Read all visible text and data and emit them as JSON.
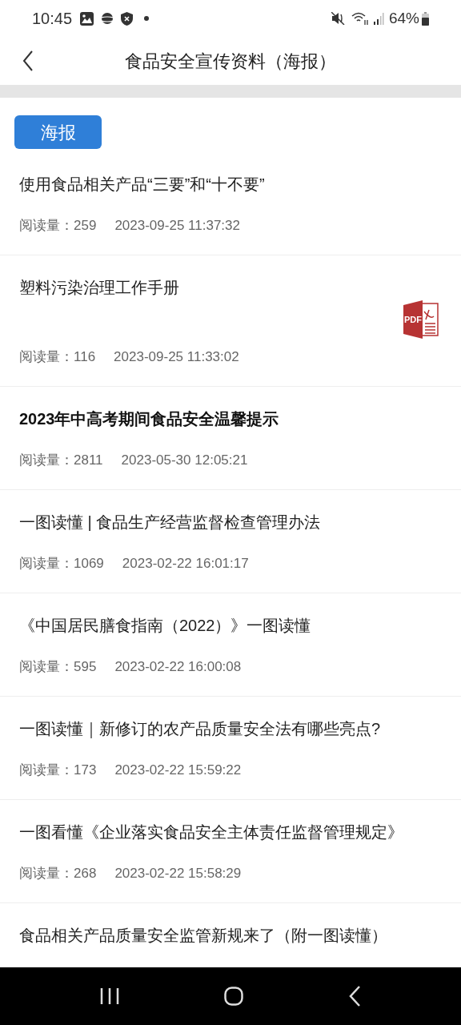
{
  "status_bar": {
    "time": "10:45",
    "battery": "64%"
  },
  "header": {
    "title": "食品安全宣传资料（海报）"
  },
  "category_tag": "海报",
  "articles": [
    {
      "title": "使用食品相关产品“三要”和“十不要”",
      "views_label": "阅读量：",
      "views": "259",
      "date": "2023-09-25 11:37:32",
      "kind": "plain",
      "emphasized": false
    },
    {
      "title": "塑料污染治理工作手册",
      "views_label": "阅读量：",
      "views": "116",
      "date": "2023-09-25 11:33:02",
      "kind": "pdf",
      "attachment_label": "PDF",
      "emphasized": false
    },
    {
      "title": "2023年中高考期间食品安全温馨提示",
      "views_label": "阅读量：",
      "views": "2811",
      "date": "2023-05-30 12:05:21",
      "kind": "plain",
      "emphasized": true
    },
    {
      "title": "一图读懂 | 食品生产经营监督检查管理办法",
      "views_label": "阅读量：",
      "views": "1069",
      "date": "2023-02-22 16:01:17",
      "kind": "plain",
      "emphasized": false
    },
    {
      "title": "《中国居民膳食指南（2022）》一图读懂",
      "views_label": "阅读量：",
      "views": "595",
      "date": "2023-02-22 16:00:08",
      "kind": "plain",
      "emphasized": false
    },
    {
      "title": "一图读懂｜新修订的农产品质量安全法有哪些亮点?",
      "views_label": "阅读量：",
      "views": "173",
      "date": "2023-02-22 15:59:22",
      "kind": "plain",
      "emphasized": false
    },
    {
      "title": "一图看懂《企业落实食品安全主体责任监督管理规定》",
      "views_label": "阅读量：",
      "views": "268",
      "date": "2023-02-22 15:58:29",
      "kind": "plain",
      "emphasized": false
    },
    {
      "title": "食品相关产品质量安全监管新规来了（附一图读懂）",
      "kind": "plain",
      "emphasized": false
    }
  ]
}
